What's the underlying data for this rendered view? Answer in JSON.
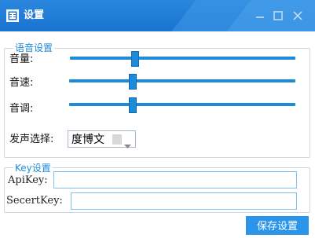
{
  "window": {
    "title": "设置"
  },
  "voice": {
    "group_title": "语音设置",
    "volume_label": "音量:",
    "volume_value": 0.29,
    "speed_label": "音速:",
    "speed_value": 0.28,
    "pitch_label": "音调:",
    "pitch_value": 0.28,
    "speaker_label": "发声选择:",
    "speaker_value": "度博文"
  },
  "key": {
    "group_title": "Key设置",
    "api_key_label": "ApiKey:",
    "api_key_value": "",
    "secret_key_label": "SecertKey:",
    "secret_key_value": ""
  },
  "actions": {
    "save_label": "保存设置"
  },
  "colors": {
    "titlebar": "#1a74d0",
    "accent": "#1e8bd8",
    "button": "#2b95ea"
  },
  "icons": [
    "app-icon",
    "minimize-icon",
    "maximize-icon",
    "close-icon",
    "dropdown-arrow-icon"
  ]
}
